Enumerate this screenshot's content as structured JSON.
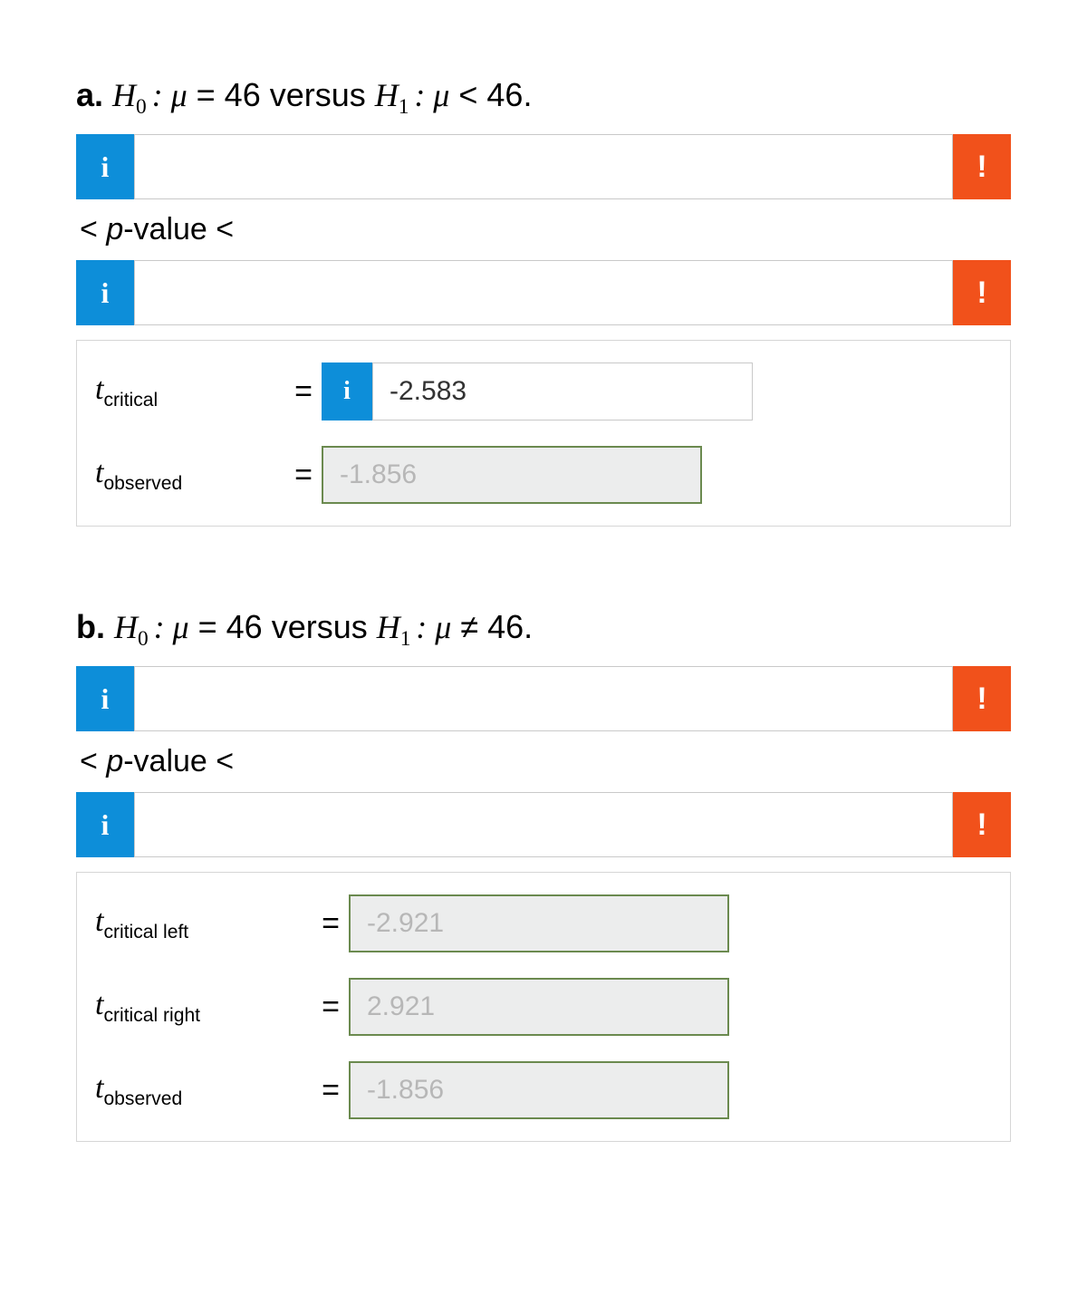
{
  "a": {
    "hypothesis_prefix": "a.",
    "hypothesis_text": "H₀ : μ = 46 versus H₁ : μ < 46.",
    "pvalue_label": "< p-value <",
    "t_critical_label": "critical",
    "t_critical_value": "-2.583",
    "t_observed_label": "observed",
    "t_observed_value": "-1.856"
  },
  "b": {
    "hypothesis_prefix": "b.",
    "hypothesis_text": "H₀ : μ = 46 versus H₁ : μ ≠ 46.",
    "pvalue_label": "< p-value <",
    "t_critical_left_label": "critical left",
    "t_critical_left_value": "-2.921",
    "t_critical_right_label": "critical right",
    "t_critical_right_value": "2.921",
    "t_observed_label": "observed",
    "t_observed_value": "-1.856"
  },
  "ui": {
    "info": "i",
    "warn": "!",
    "eq": "="
  }
}
